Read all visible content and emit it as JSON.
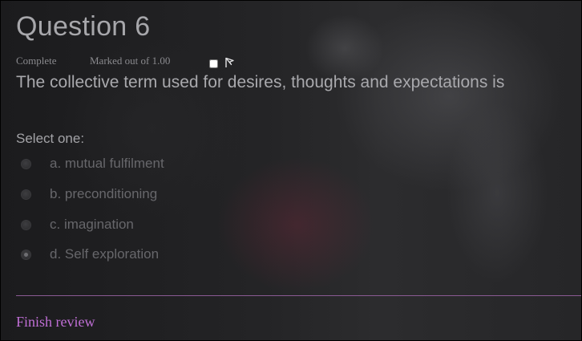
{
  "question": {
    "title": "Question 6",
    "status": "Complete",
    "mark": "Marked out of 1.00",
    "text": "The collective term used for desires, thoughts and expectations is",
    "flagged": false,
    "flag_icon": "flag-outline-icon"
  },
  "answer": {
    "prompt": "Select one:",
    "options": [
      {
        "label": "a. mutual fulfilment",
        "selected": false
      },
      {
        "label": "b. preconditioning",
        "selected": false
      },
      {
        "label": "c. imagination",
        "selected": false
      },
      {
        "label": "d. Self exploration",
        "selected": true
      }
    ]
  },
  "footer": {
    "finish_label": "Finish review"
  },
  "colors": {
    "accent": "#c06fd6",
    "divider": "#8a5a93"
  }
}
